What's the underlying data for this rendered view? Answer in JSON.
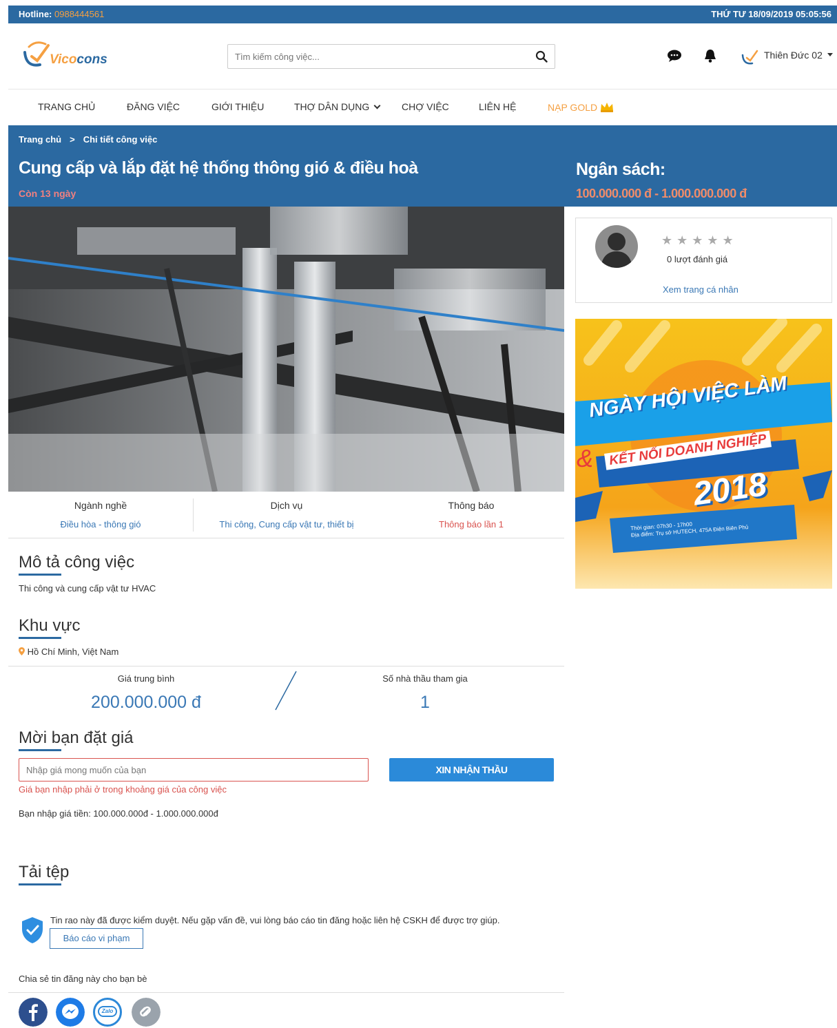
{
  "topbar": {
    "hotline_label": "Hotline:",
    "hotline_number": "0988444561",
    "datetime": "THỨ TƯ 18/09/2019 05:05:56"
  },
  "header": {
    "logo_text_a": "Vico",
    "logo_text_b": "cons",
    "search_placeholder": "Tìm kiếm công việc...",
    "user_name": "Thiên Đức 02"
  },
  "nav": {
    "items": [
      "TRANG CHỦ",
      "ĐĂNG VIỆC",
      "GIỚI THIỆU",
      "THỢ DÂN DỤNG",
      "CHỢ VIỆC",
      "LIÊN HỆ",
      "NẠP GOLD"
    ]
  },
  "breadcrumb": {
    "home": "Trang chủ",
    "sep": ">",
    "current": "Chi tiết công việc"
  },
  "job": {
    "title": "Cung cấp và lắp đặt hệ thống thông gió & điều hoà",
    "remaining": "Còn 13 ngày",
    "budget_label": "Ngân sách:",
    "budget_value": "100.000.000 đ - 1.000.000.000 đ"
  },
  "info": {
    "industry_label": "Ngành nghề",
    "industry_value": "Điều hòa - thông gió",
    "service_label": "Dịch vụ",
    "service_value": "Thi công, Cung cấp vật tư, thiết bị",
    "notice_label": "Thông báo",
    "notice_value": "Thông báo lần 1"
  },
  "description": {
    "heading": "Mô tả công việc",
    "text": "Thi công và cung cấp vật tư HVAC"
  },
  "area": {
    "heading": "Khu vực",
    "text": "Hồ Chí Minh, Việt Nam"
  },
  "stats": {
    "avg_label": "Giá trung bình",
    "avg_value": "200.000.000 đ",
    "bidders_label": "Số nhà thầu tham gia",
    "bidders_value": "1"
  },
  "bid": {
    "heading": "Mời bạn đặt giá",
    "placeholder": "Nhập giá mong muốn của bạn",
    "button": "XIN NHẬN THẦU",
    "error": "Giá bạn nhập phải ở trong khoảng giá của công việc",
    "range_text": "Bạn nhập giá tiền: 100.000.000đ - 1.000.000.000đ"
  },
  "files": {
    "heading": "Tải tệp"
  },
  "verify": {
    "text": "Tin rao này đã được kiểm duyệt. Nếu gặp vấn đề, vui lòng báo cáo tin đăng hoặc liên hệ CSKH để được trợ giúp.",
    "report_button": "Báo cáo vi phạm"
  },
  "share": {
    "label": "Chia sẻ tin đăng này cho bạn bè",
    "zalo": "Zalo"
  },
  "profile": {
    "stars": "★★★★★",
    "ratings": "0 lượt đánh giá",
    "view_link": "Xem trang cá nhân"
  },
  "ad": {
    "title": "NGÀY HỘI VIỆC LÀM",
    "amp": "&",
    "subtitle": "KẾT NỐI DOANH NGHIỆP",
    "year": "2018",
    "time": "Thời gian: 07h30 - 17h00",
    "place": "Địa điểm: Trụ sở HUTECH, 475A Điện Biên Phủ"
  },
  "colors": {
    "brand_blue": "#2b69a1",
    "accent_orange": "#f5a042",
    "link_blue": "#3a78b5",
    "error_red": "#d9534f"
  }
}
